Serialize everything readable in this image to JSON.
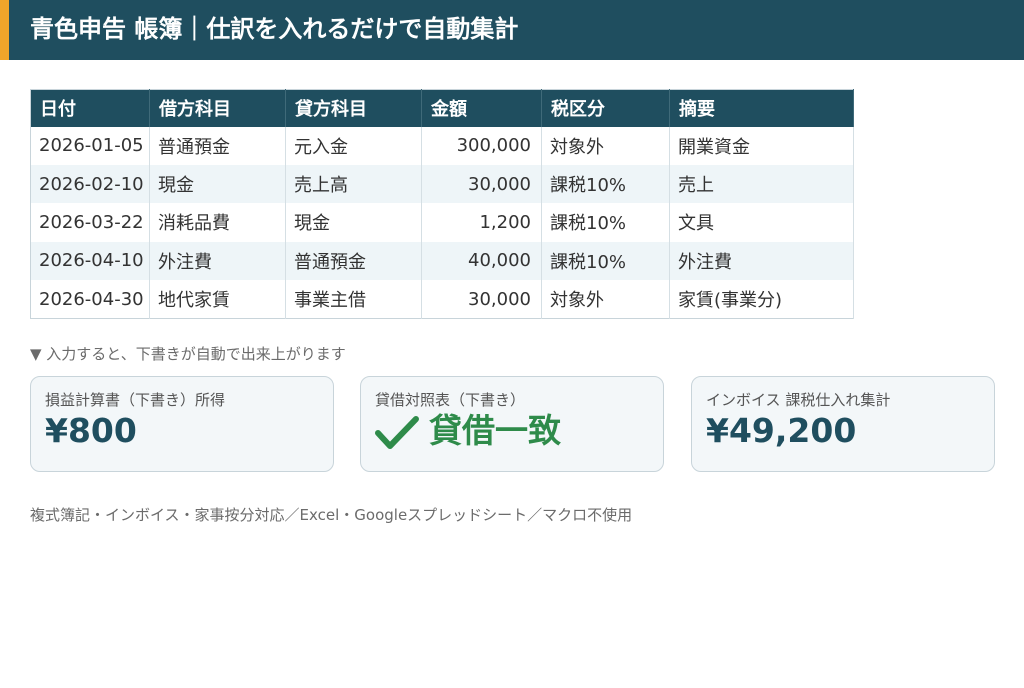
{
  "header": {
    "title": "青色申告 帳簿｜仕訳を入れるだけで自動集計",
    "accent_color": "#f0a52a",
    "background_color": "#1f4e5f"
  },
  "ledger": {
    "columns": [
      "日付",
      "借方科目",
      "貸方科目",
      "金額",
      "税区分",
      "摘要"
    ],
    "rows": [
      {
        "date": "2026-01-05",
        "debit": "普通預金",
        "credit": "元入金",
        "amount": "300,000",
        "tax": "対象外",
        "memo": "開業資金"
      },
      {
        "date": "2026-02-10",
        "debit": "現金",
        "credit": "売上高",
        "amount": "30,000",
        "tax": "課税10%",
        "memo": "売上"
      },
      {
        "date": "2026-03-22",
        "debit": "消耗品費",
        "credit": "現金",
        "amount": "1,200",
        "tax": "課税10%",
        "memo": "文具"
      },
      {
        "date": "2026-04-10",
        "debit": "外注費",
        "credit": "普通預金",
        "amount": "40,000",
        "tax": "課税10%",
        "memo": "外注費"
      },
      {
        "date": "2026-04-30",
        "debit": "地代家賃",
        "credit": "事業主借",
        "amount": "30,000",
        "tax": "対象外",
        "memo": "家賃(事業分)"
      }
    ]
  },
  "hint": "▼ 入力すると、下書きが自動で出来上がります",
  "cards": [
    {
      "label": "損益計算書（下書き）所得",
      "value": "¥800"
    },
    {
      "label": "貸借対照表（下書き）",
      "value": "貸借一致",
      "icon": "check-icon",
      "status_color": "#2e8b4a"
    },
    {
      "label": "インボイス 課税仕入れ集計",
      "value": "¥49,200"
    }
  ],
  "footer_note": "複式簿記・インボイス・家事按分対応／Excel・Googleスプレッドシート／マクロ不使用"
}
